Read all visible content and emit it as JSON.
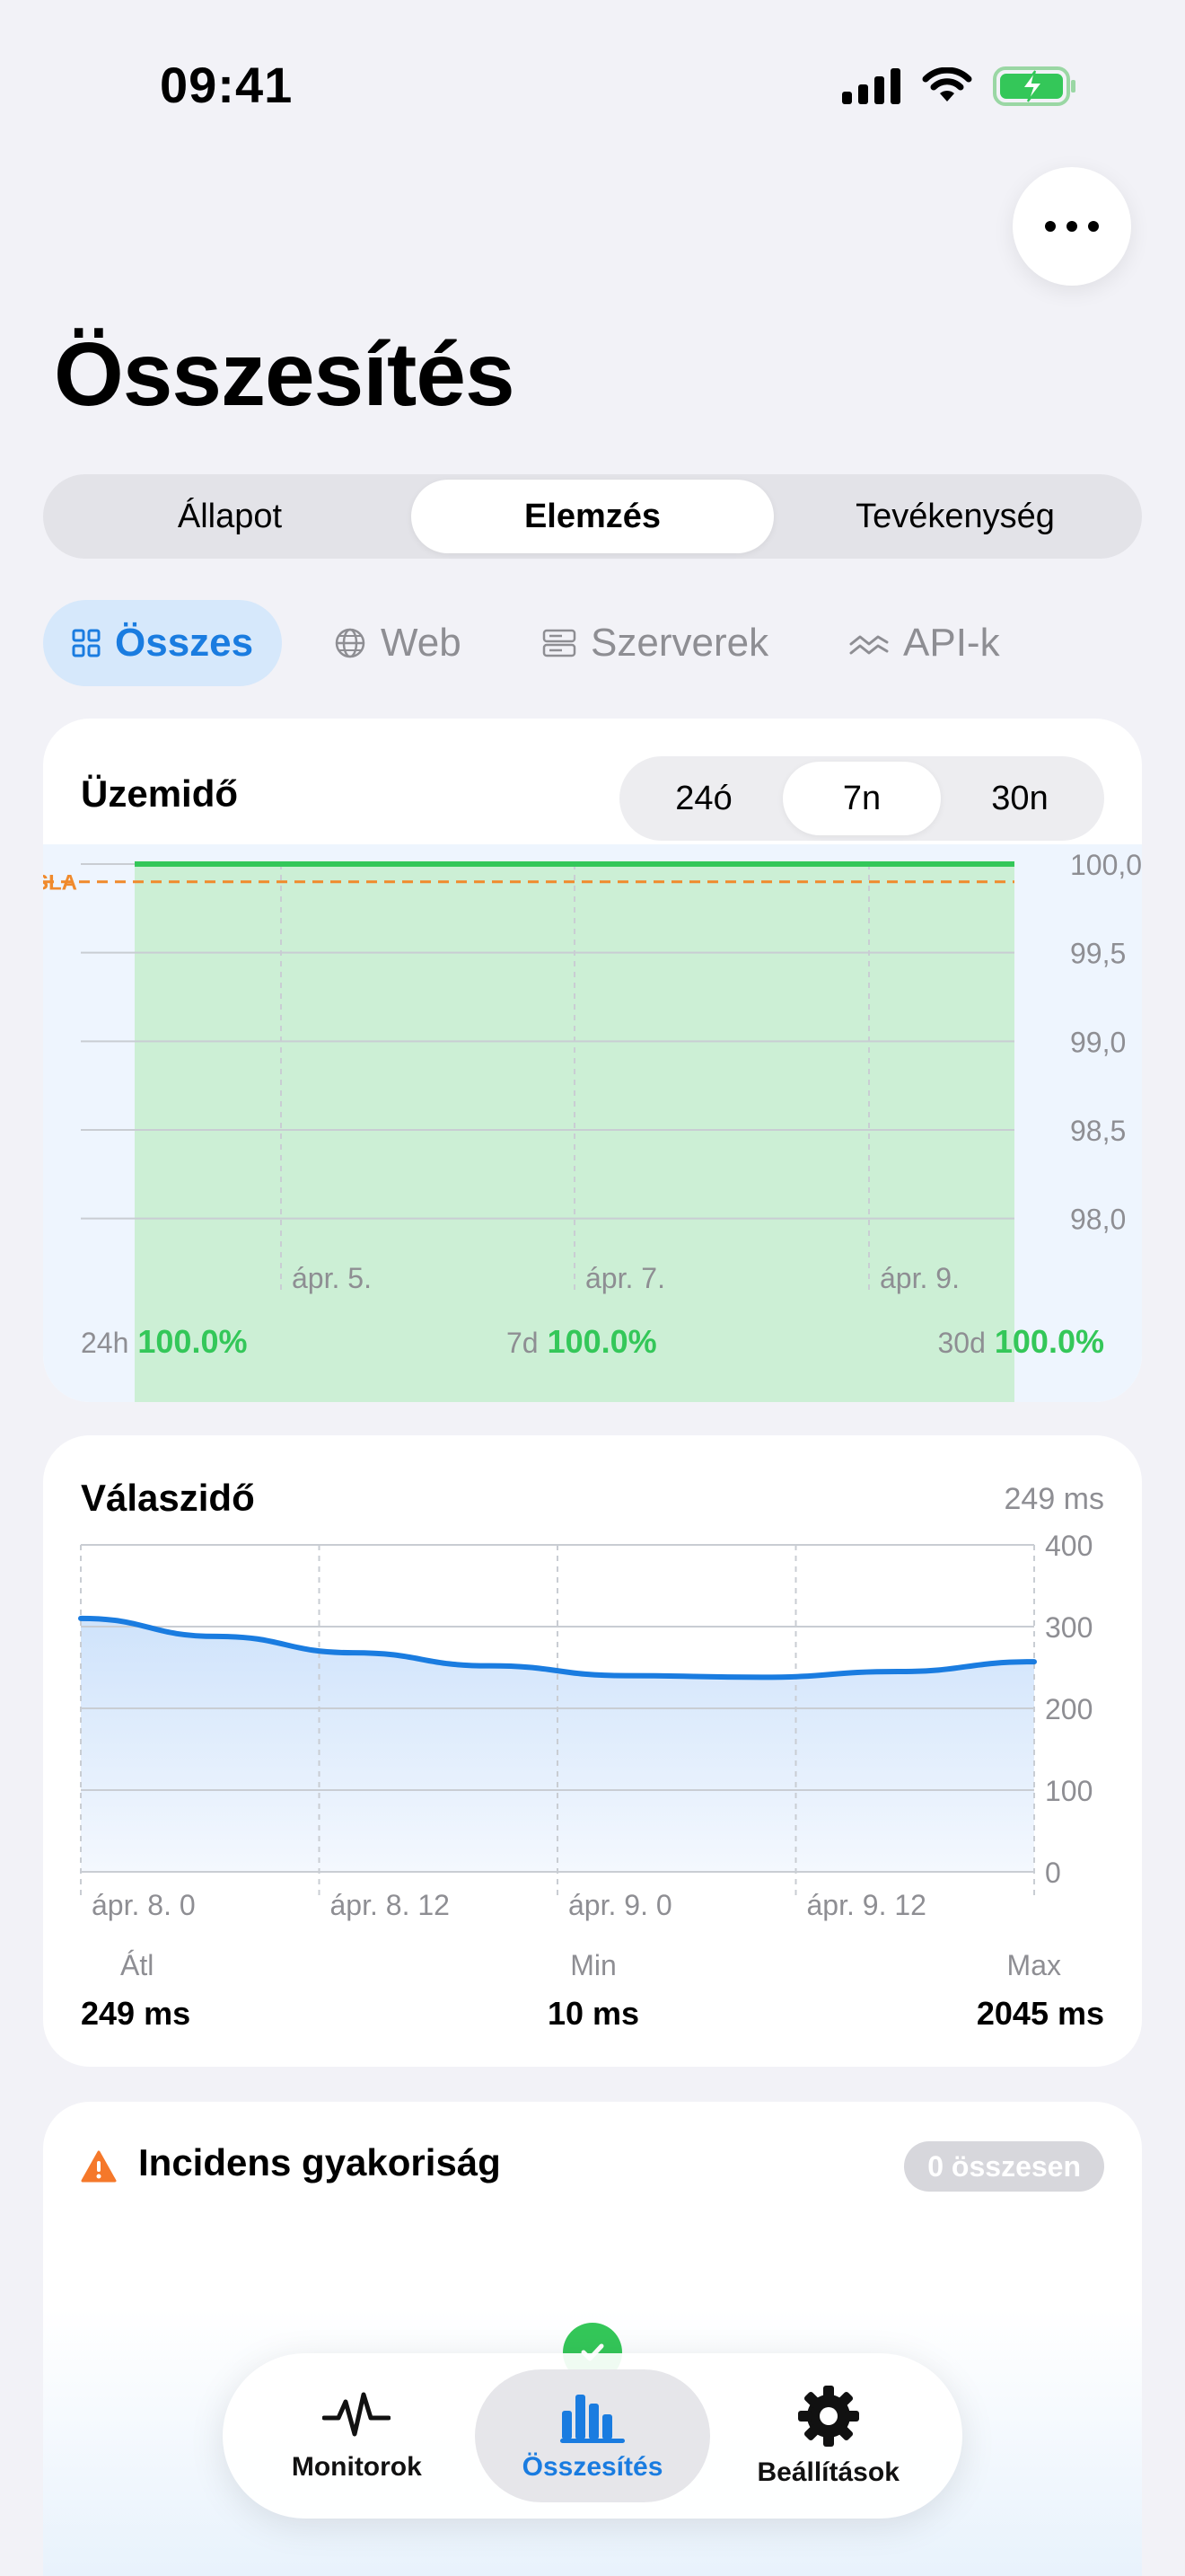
{
  "status_bar": {
    "time": "09:41"
  },
  "page": {
    "title": "Összesítés"
  },
  "segmented": {
    "items": [
      "Állapot",
      "Elemzés",
      "Tevékenység"
    ],
    "active": "Elemzés"
  },
  "filters": {
    "items": [
      "Összes",
      "Web",
      "Szerverek",
      "API-k"
    ],
    "active": "Összes"
  },
  "uptime": {
    "title": "Üzemidő",
    "ranges": [
      "24ó",
      "7n",
      "30n"
    ],
    "active_range": "7n",
    "sla_label": "SLA",
    "stats": [
      {
        "label": "24h",
        "value": "100.0%"
      },
      {
        "label": "7d",
        "value": "100.0%"
      },
      {
        "label": "30d",
        "value": "100.0%"
      }
    ]
  },
  "response": {
    "title": "Válaszidő",
    "current": "249 ms",
    "stats": [
      {
        "label": "Átl",
        "value": "249 ms"
      },
      {
        "label": "Min",
        "value": "10 ms"
      },
      {
        "label": "Max",
        "value": "2045 ms"
      }
    ]
  },
  "incidents": {
    "title": "Incidens gyakoriság",
    "badge": "0 összesen"
  },
  "tabbar": {
    "items": [
      "Monitorok",
      "Összesítés",
      "Beállítások"
    ],
    "active": "Összesítés"
  },
  "colors": {
    "accent": "#1a7ce0",
    "success": "#34c759",
    "sla": "#f08a2c",
    "warning": "#f5782a"
  },
  "chart_data": [
    {
      "type": "area",
      "title": "Üzemidő",
      "x": [
        "ápr. 5.",
        "ápr. 7.",
        "ápr. 9."
      ],
      "series": [
        {
          "values": [
            100.0,
            100.0,
            100.0
          ]
        }
      ],
      "sla": 99.9,
      "ylim": [
        97.75,
        100.0
      ],
      "yticks": [
        "100,0",
        "99,5",
        "99,0",
        "98,5",
        "98,0"
      ],
      "xticks": [
        "ápr. 5.",
        "ápr. 7.",
        "ápr. 9."
      ],
      "grid": true
    },
    {
      "type": "area",
      "title": "Válaszidő",
      "x": [
        "ápr. 8. 0",
        "ápr. 8. 6",
        "ápr. 8. 12",
        "ápr. 8. 18",
        "ápr. 9. 0",
        "ápr. 9. 6",
        "ápr. 9. 12",
        "ápr. 9. 18"
      ],
      "series": [
        {
          "values": [
            310,
            288,
            268,
            252,
            240,
            238,
            245,
            257
          ]
        }
      ],
      "ylim": [
        0,
        400
      ],
      "yticks": [
        "400",
        "300",
        "200",
        "100",
        "0"
      ],
      "xticks": [
        "ápr. 8. 0",
        "ápr. 8. 12",
        "ápr. 9. 0",
        "ápr. 9. 12"
      ],
      "grid": true
    }
  ]
}
